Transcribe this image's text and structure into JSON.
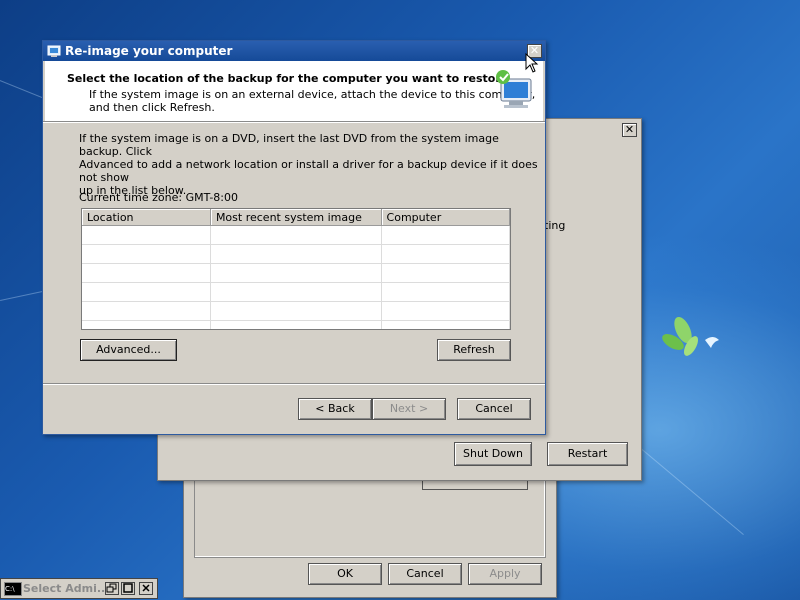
{
  "background_dialog": {
    "partial_text": "ting",
    "shutdown_label": "Shut Down",
    "restart_label": "Restart"
  },
  "bottom_dialog": {
    "ok_label": "OK",
    "cancel_label": "Cancel",
    "apply_label": "Apply"
  },
  "main_dialog": {
    "title": "Re-image your computer",
    "heading": "Select the location of the backup for the computer you want to restore",
    "subheading_line1": "If the system image is on an external device, attach the device to this computer,",
    "subheading_line2": "and then click Refresh.",
    "info_line1": "If the system image is on a DVD, insert the last DVD from the system image backup. Click",
    "info_line2": "Advanced to add a network location or install a driver for a backup device if it does not show",
    "info_line3": "up in the list below.",
    "timezone": "Current time zone: GMT-8:00",
    "table": {
      "columns": [
        "Location",
        "Most recent system image",
        "Computer"
      ],
      "rows": [
        [
          "",
          "",
          ""
        ],
        [
          "",
          "",
          ""
        ],
        [
          "",
          "",
          ""
        ],
        [
          "",
          "",
          ""
        ],
        [
          "",
          "",
          ""
        ],
        [
          "",
          "",
          ""
        ]
      ]
    },
    "advanced_label": "Advanced...",
    "refresh_label": "Refresh",
    "back_label": "< Back",
    "next_label": "Next >",
    "cancel_label": "Cancel",
    "close_glyph": "✕"
  },
  "taskbar": {
    "app_label": "Select Admi..."
  },
  "colors": {
    "titlebar": "#1c50a0",
    "dialog_face": "#d4d0c8",
    "desktop": "#1a5aa8"
  }
}
